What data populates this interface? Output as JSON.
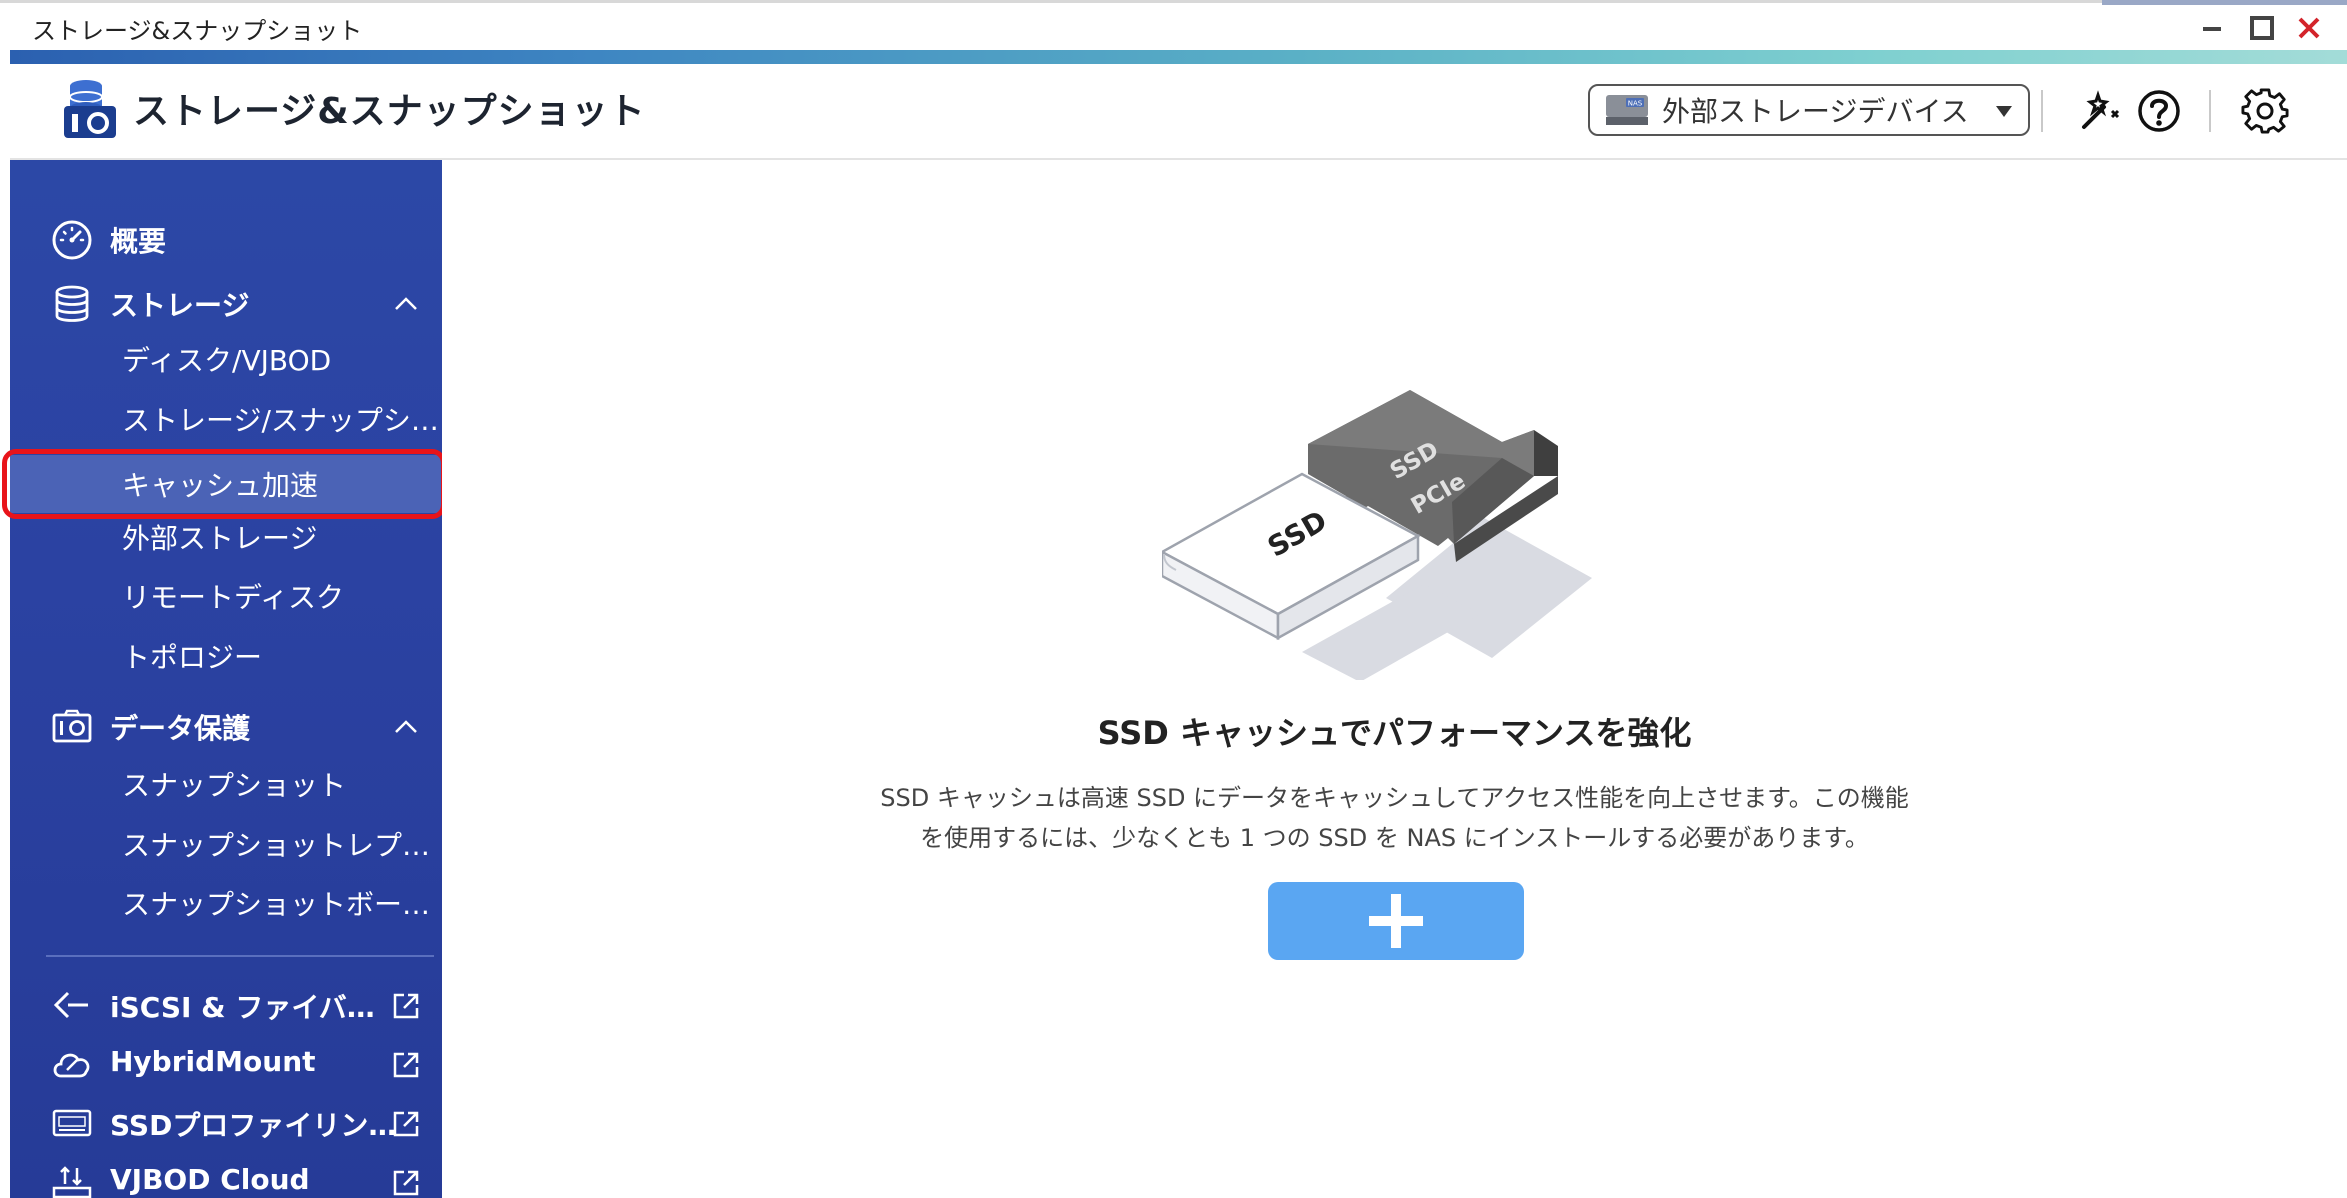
{
  "window": {
    "title": "ストレージ&スナップショット"
  },
  "header": {
    "app_title": "ストレージ&スナップショット",
    "device_select": {
      "selected": "外部ストレージデバイス",
      "icon": "hdd-icon",
      "hdd_badge": "NAS"
    },
    "icons": [
      "wizard-icon",
      "help-icon",
      "settings-icon"
    ]
  },
  "sidebar": {
    "groups": [
      {
        "label": "概要",
        "icon": "gauge-icon"
      },
      {
        "label": "ストレージ",
        "icon": "database-icon",
        "expanded": true,
        "items": [
          {
            "label": "ディスク/VJBOD"
          },
          {
            "label": "ストレージ/スナップショット"
          },
          {
            "label": "キャッシュ加速",
            "active": true
          },
          {
            "label": "外部ストレージ"
          },
          {
            "label": "リモートディスク"
          },
          {
            "label": "トポロジー"
          }
        ]
      },
      {
        "label": "データ保護",
        "icon": "camera-icon",
        "expanded": true,
        "items": [
          {
            "label": "スナップショット"
          },
          {
            "label": "スナップショットレプリカ"
          },
          {
            "label": "スナップショットボールト"
          }
        ]
      }
    ],
    "external_links": [
      {
        "label": "iSCSI & ファイバーチャネル",
        "icon": "iscsi-icon"
      },
      {
        "label": "HybridMount",
        "icon": "cloud-icon"
      },
      {
        "label": "SSDプロファイリングツール",
        "icon": "ssd-icon"
      },
      {
        "label": "VJBOD Cloud",
        "icon": "vjbod-cloud-icon"
      }
    ]
  },
  "main": {
    "illustration": {
      "ssd_label": "SSD",
      "pcie_label_top": "SSD",
      "pcie_label_bottom": "PCIe"
    },
    "title": "SSD キャッシュでパフォーマンスを強化",
    "description": "SSD キャッシュは高速 SSD にデータをキャッシュしてアクセス性能を向上させます。この機能を使用するには、少なくとも 1 つの SSD を NAS にインストールする必要があります。",
    "add_button_icon": "plus-icon"
  },
  "colors": {
    "sidebar_bg": "#2c48a6",
    "sidebar_active": "#4b63b6",
    "add_button": "#5aa6f2",
    "highlight": "#e8141a"
  }
}
